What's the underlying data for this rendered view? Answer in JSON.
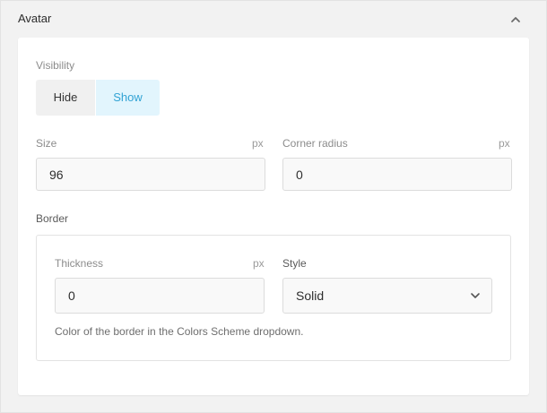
{
  "panel": {
    "title": "Avatar"
  },
  "visibility": {
    "label": "Visibility",
    "options": [
      "Hide",
      "Show"
    ],
    "selected": "Show"
  },
  "size": {
    "label": "Size",
    "unit": "px",
    "value": "96"
  },
  "corner_radius": {
    "label": "Corner radius",
    "unit": "px",
    "value": "0"
  },
  "border": {
    "label": "Border",
    "thickness": {
      "label": "Thickness",
      "unit": "px",
      "value": "0"
    },
    "style": {
      "label": "Style",
      "value": "Solid"
    },
    "helper_text": "Color of the border in the Colors Scheme dropdown."
  },
  "colors": {
    "accent": "#31a3d4",
    "accent_bg": "#e2f5fd"
  },
  "icons": {
    "collapse": "chevron-up-icon",
    "dropdown": "chevron-down-icon"
  }
}
